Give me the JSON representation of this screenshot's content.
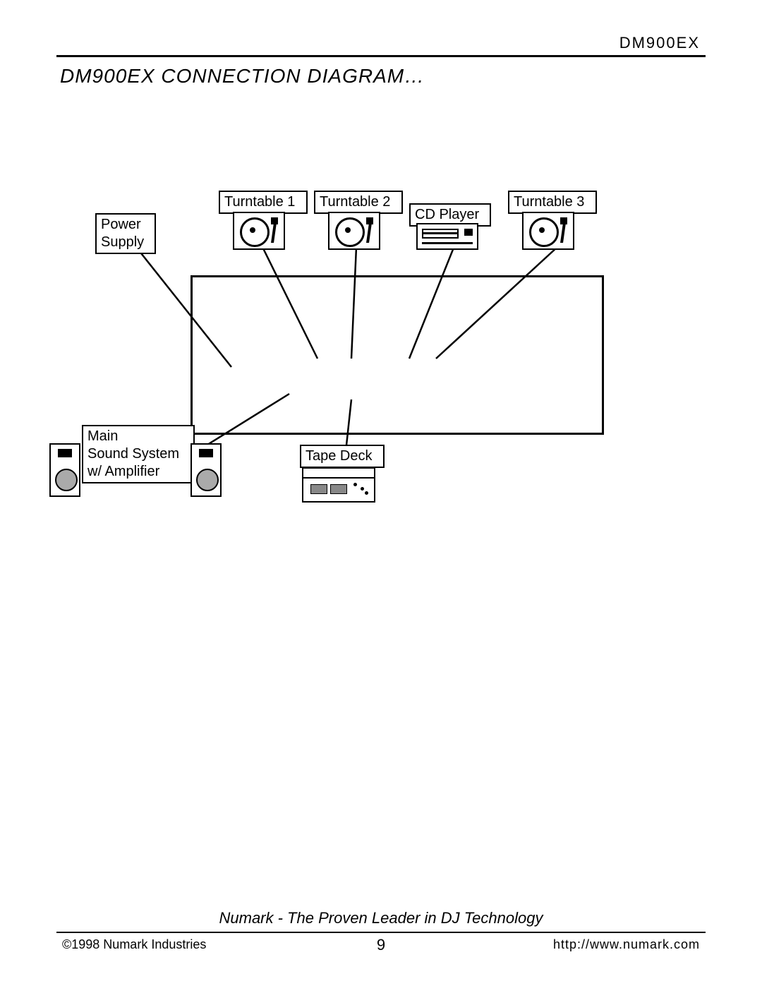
{
  "header": {
    "model": "DM900EX"
  },
  "title": "DM900EX CONNECTION DIAGRAM…",
  "labels": {
    "turntable1": "Turntable 1",
    "turntable2": "Turntable 2",
    "turntable3": "Turntable 3",
    "cd_player": "CD Player",
    "power_supply_l1": "Power",
    "power_supply_l2": "Supply",
    "main_l1": "Main",
    "main_l2": "Sound System",
    "main_l3": "w/ Amplifier",
    "tape_deck": "Tape Deck"
  },
  "footer": {
    "slogan": "Numark - The Proven Leader in DJ Technology",
    "copyright": "©1998 Numark Industries",
    "page": "9",
    "url": "http://www.numark.com"
  }
}
